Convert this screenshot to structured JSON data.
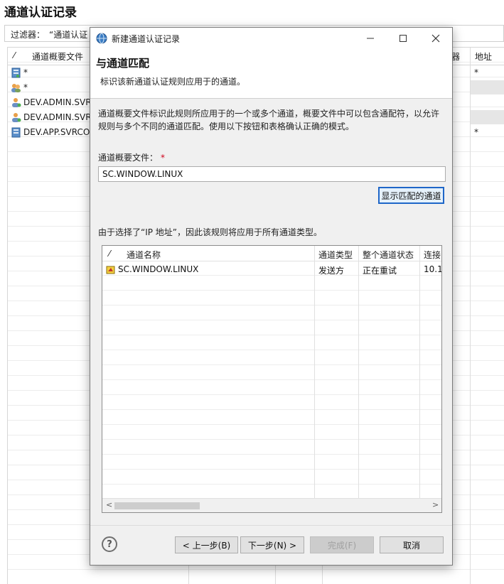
{
  "background": {
    "title": "通道认证记录",
    "filter_label": "过滤器：",
    "filter_value": "“通道认证",
    "columns": {
      "profile": "通道概要文件",
      "address_hdr_partial": "器",
      "address": "地址"
    },
    "rows": [
      {
        "icon": "server-icon",
        "label": "*"
      },
      {
        "icon": "users-icon",
        "label": "*"
      },
      {
        "icon": "user-icon",
        "label": "DEV.ADMIN.SVR"
      },
      {
        "icon": "user-icon",
        "label": "DEV.ADMIN.SVR"
      },
      {
        "icon": "server-icon",
        "label": "DEV.APP.SVRCO"
      }
    ],
    "address_values": [
      "*",
      "*"
    ]
  },
  "dialog": {
    "title": "新建通道认证记录",
    "header_title": "与通道匹配",
    "header_subtitle": "标识该新通道认证规则应用于的通道。",
    "description": "通道概要文件标识此规则所应用于的一个或多个通道，概要文件中可以包含通配符，以允许规则与多个不同的通道匹配。使用以下按钮和表格确认正确的模式。",
    "field_label": "通道概要文件：",
    "required_mark": "*",
    "field_value": "SC.WINDOW.LINUX",
    "show_button": "显示匹配的通道",
    "info_text": "由于选择了“IP 地址”，因此该规则将应用于所有通道类型。",
    "table": {
      "columns": [
        "通道名称",
        "通道类型",
        "整个通道状态",
        "连接"
      ],
      "rows": [
        {
          "name": "SC.WINDOW.LINUX",
          "type": "发送方",
          "status": "正在重试",
          "conn": "10.1"
        }
      ]
    },
    "buttons": {
      "back": "< 上一步(B)",
      "next": "下一步(N) >",
      "finish": "完成(F)",
      "cancel": "取消"
    },
    "help": "?"
  },
  "colors": {
    "focus_blue": "#1e66c8",
    "required_red": "#d0021b"
  }
}
